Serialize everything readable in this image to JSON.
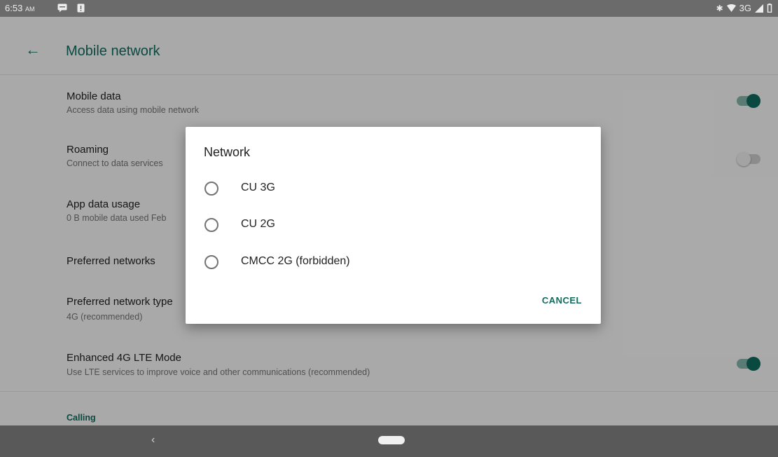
{
  "status_bar": {
    "time": "6:53",
    "ampm": "AM",
    "network": "3G"
  },
  "app_bar": {
    "title": "Mobile network"
  },
  "settings": [
    {
      "title": "Mobile data",
      "summary": "Access data using mobile network",
      "toggle": "on"
    },
    {
      "title": "Roaming",
      "summary": "Connect to data services",
      "toggle": "off"
    },
    {
      "title": "App data usage",
      "summary": "0 B mobile data used Feb"
    },
    {
      "title": "Preferred networks",
      "summary": ""
    },
    {
      "title": "Preferred network type",
      "summary": "4G (recommended)"
    },
    {
      "title": "Enhanced 4G LTE Mode",
      "summary": "Use LTE services to improve voice and other communications (recommended)",
      "toggle": "on"
    }
  ],
  "category": "Calling",
  "dialog": {
    "title": "Network",
    "options": [
      {
        "label": "CU 3G",
        "selected": false
      },
      {
        "label": "CU 2G",
        "selected": false
      },
      {
        "label": "CMCC 2G (forbidden)",
        "selected": false
      }
    ],
    "cancel_label": "CANCEL"
  },
  "nav_bar": {
    "back_glyph": "‹"
  },
  "colors": {
    "accent": "#0f6c5f",
    "toggle_track_on": "#86b7ad",
    "scrim": "rgba(0,0,0,0.32)"
  }
}
